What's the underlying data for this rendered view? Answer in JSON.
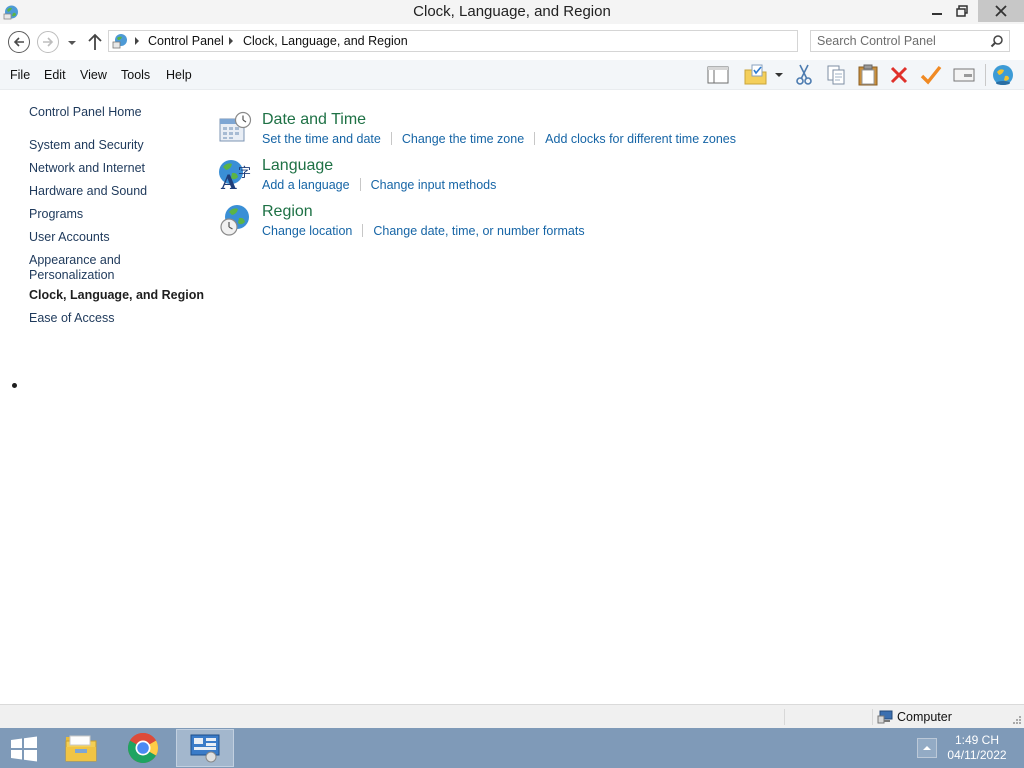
{
  "window": {
    "title": "Clock, Language, and Region",
    "app_icon": "control-panel-globe-icon"
  },
  "address_bar": {
    "breadcrumbs": [
      "Control Panel",
      "Clock, Language, and Region"
    ],
    "search_placeholder": "Search Control Panel"
  },
  "menu": {
    "items": [
      "File",
      "Edit",
      "View",
      "Tools",
      "Help"
    ]
  },
  "toolbar": {
    "icons": [
      "layout-pane-icon",
      "folder-check-icon",
      "dropdown-arrow-icon",
      "cut-icon",
      "copy-icon",
      "paste-icon",
      "delete-icon",
      "checkmark-icon",
      "properties-icon",
      "shell-globe-icon"
    ]
  },
  "left_nav": {
    "home": "Control Panel Home",
    "items": [
      {
        "label": "System and Security"
      },
      {
        "label": "Network and Internet"
      },
      {
        "label": "Hardware and Sound"
      },
      {
        "label": "Programs"
      },
      {
        "label": "User Accounts"
      },
      {
        "label": "Appearance and\nPersonalization"
      },
      {
        "label": "Clock, Language, and Region",
        "current": true
      },
      {
        "label": "Ease of Access"
      }
    ]
  },
  "categories": [
    {
      "title": "Date and Time",
      "icon": "date-time-icon",
      "links": [
        "Set the time and date",
        "Change the time zone",
        "Add clocks for different time zones"
      ]
    },
    {
      "title": "Language",
      "icon": "language-icon",
      "links": [
        "Add a language",
        "Change input methods"
      ]
    },
    {
      "title": "Region",
      "icon": "region-globe-icon",
      "links": [
        "Change location",
        "Change date, time, or number formats"
      ]
    }
  ],
  "status_bar": {
    "location": "Computer"
  },
  "taskbar": {
    "apps": [
      "file-explorer-icon",
      "chrome-icon",
      "control-panel-icon"
    ],
    "active_app": "control-panel-icon",
    "clock_time": "1:49 CH",
    "clock_date": "04/11/2022"
  },
  "colors": {
    "link": "#1665a6",
    "category_title": "#1e7145",
    "nav_link": "#1e395b",
    "taskbar": "#7f9ab8",
    "close_button": "#c7c7c7"
  }
}
